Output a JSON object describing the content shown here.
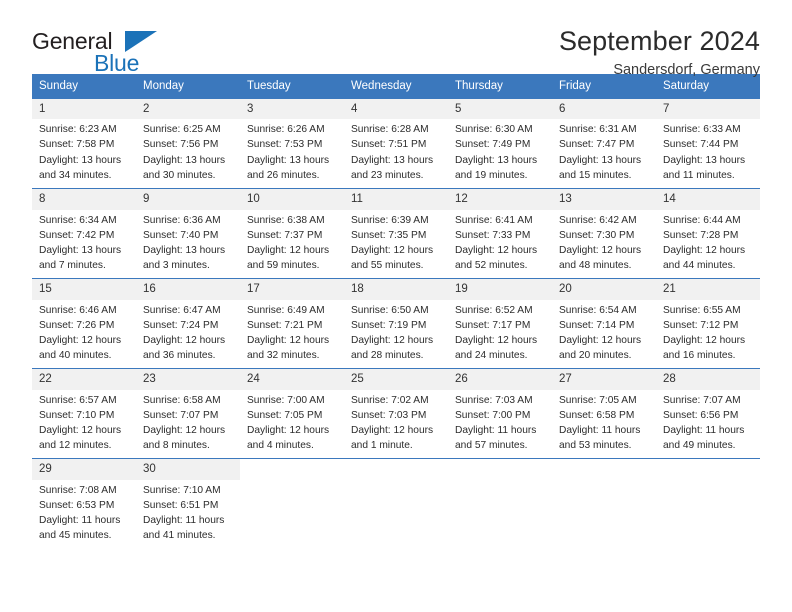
{
  "brand": {
    "line1": "General",
    "line2": "Blue",
    "triangle_color": "#1b72b8"
  },
  "header": {
    "title": "September 2024",
    "subtitle": "Sandersdorf, Germany"
  },
  "theme": {
    "header_blue": "#3b78bd",
    "daynum_gray": "#f1f1f1",
    "text": "#2c2c2c"
  },
  "columns": [
    "Sunday",
    "Monday",
    "Tuesday",
    "Wednesday",
    "Thursday",
    "Friday",
    "Saturday"
  ],
  "weeks": [
    [
      {
        "day": "1",
        "sunrise": "Sunrise: 6:23 AM",
        "sunset": "Sunset: 7:58 PM",
        "daylight1": "Daylight: 13 hours",
        "daylight2": "and 34 minutes."
      },
      {
        "day": "2",
        "sunrise": "Sunrise: 6:25 AM",
        "sunset": "Sunset: 7:56 PM",
        "daylight1": "Daylight: 13 hours",
        "daylight2": "and 30 minutes."
      },
      {
        "day": "3",
        "sunrise": "Sunrise: 6:26 AM",
        "sunset": "Sunset: 7:53 PM",
        "daylight1": "Daylight: 13 hours",
        "daylight2": "and 26 minutes."
      },
      {
        "day": "4",
        "sunrise": "Sunrise: 6:28 AM",
        "sunset": "Sunset: 7:51 PM",
        "daylight1": "Daylight: 13 hours",
        "daylight2": "and 23 minutes."
      },
      {
        "day": "5",
        "sunrise": "Sunrise: 6:30 AM",
        "sunset": "Sunset: 7:49 PM",
        "daylight1": "Daylight: 13 hours",
        "daylight2": "and 19 minutes."
      },
      {
        "day": "6",
        "sunrise": "Sunrise: 6:31 AM",
        "sunset": "Sunset: 7:47 PM",
        "daylight1": "Daylight: 13 hours",
        "daylight2": "and 15 minutes."
      },
      {
        "day": "7",
        "sunrise": "Sunrise: 6:33 AM",
        "sunset": "Sunset: 7:44 PM",
        "daylight1": "Daylight: 13 hours",
        "daylight2": "and 11 minutes."
      }
    ],
    [
      {
        "day": "8",
        "sunrise": "Sunrise: 6:34 AM",
        "sunset": "Sunset: 7:42 PM",
        "daylight1": "Daylight: 13 hours",
        "daylight2": "and 7 minutes."
      },
      {
        "day": "9",
        "sunrise": "Sunrise: 6:36 AM",
        "sunset": "Sunset: 7:40 PM",
        "daylight1": "Daylight: 13 hours",
        "daylight2": "and 3 minutes."
      },
      {
        "day": "10",
        "sunrise": "Sunrise: 6:38 AM",
        "sunset": "Sunset: 7:37 PM",
        "daylight1": "Daylight: 12 hours",
        "daylight2": "and 59 minutes."
      },
      {
        "day": "11",
        "sunrise": "Sunrise: 6:39 AM",
        "sunset": "Sunset: 7:35 PM",
        "daylight1": "Daylight: 12 hours",
        "daylight2": "and 55 minutes."
      },
      {
        "day": "12",
        "sunrise": "Sunrise: 6:41 AM",
        "sunset": "Sunset: 7:33 PM",
        "daylight1": "Daylight: 12 hours",
        "daylight2": "and 52 minutes."
      },
      {
        "day": "13",
        "sunrise": "Sunrise: 6:42 AM",
        "sunset": "Sunset: 7:30 PM",
        "daylight1": "Daylight: 12 hours",
        "daylight2": "and 48 minutes."
      },
      {
        "day": "14",
        "sunrise": "Sunrise: 6:44 AM",
        "sunset": "Sunset: 7:28 PM",
        "daylight1": "Daylight: 12 hours",
        "daylight2": "and 44 minutes."
      }
    ],
    [
      {
        "day": "15",
        "sunrise": "Sunrise: 6:46 AM",
        "sunset": "Sunset: 7:26 PM",
        "daylight1": "Daylight: 12 hours",
        "daylight2": "and 40 minutes."
      },
      {
        "day": "16",
        "sunrise": "Sunrise: 6:47 AM",
        "sunset": "Sunset: 7:24 PM",
        "daylight1": "Daylight: 12 hours",
        "daylight2": "and 36 minutes."
      },
      {
        "day": "17",
        "sunrise": "Sunrise: 6:49 AM",
        "sunset": "Sunset: 7:21 PM",
        "daylight1": "Daylight: 12 hours",
        "daylight2": "and 32 minutes."
      },
      {
        "day": "18",
        "sunrise": "Sunrise: 6:50 AM",
        "sunset": "Sunset: 7:19 PM",
        "daylight1": "Daylight: 12 hours",
        "daylight2": "and 28 minutes."
      },
      {
        "day": "19",
        "sunrise": "Sunrise: 6:52 AM",
        "sunset": "Sunset: 7:17 PM",
        "daylight1": "Daylight: 12 hours",
        "daylight2": "and 24 minutes."
      },
      {
        "day": "20",
        "sunrise": "Sunrise: 6:54 AM",
        "sunset": "Sunset: 7:14 PM",
        "daylight1": "Daylight: 12 hours",
        "daylight2": "and 20 minutes."
      },
      {
        "day": "21",
        "sunrise": "Sunrise: 6:55 AM",
        "sunset": "Sunset: 7:12 PM",
        "daylight1": "Daylight: 12 hours",
        "daylight2": "and 16 minutes."
      }
    ],
    [
      {
        "day": "22",
        "sunrise": "Sunrise: 6:57 AM",
        "sunset": "Sunset: 7:10 PM",
        "daylight1": "Daylight: 12 hours",
        "daylight2": "and 12 minutes."
      },
      {
        "day": "23",
        "sunrise": "Sunrise: 6:58 AM",
        "sunset": "Sunset: 7:07 PM",
        "daylight1": "Daylight: 12 hours",
        "daylight2": "and 8 minutes."
      },
      {
        "day": "24",
        "sunrise": "Sunrise: 7:00 AM",
        "sunset": "Sunset: 7:05 PM",
        "daylight1": "Daylight: 12 hours",
        "daylight2": "and 4 minutes."
      },
      {
        "day": "25",
        "sunrise": "Sunrise: 7:02 AM",
        "sunset": "Sunset: 7:03 PM",
        "daylight1": "Daylight: 12 hours",
        "daylight2": "and 1 minute."
      },
      {
        "day": "26",
        "sunrise": "Sunrise: 7:03 AM",
        "sunset": "Sunset: 7:00 PM",
        "daylight1": "Daylight: 11 hours",
        "daylight2": "and 57 minutes."
      },
      {
        "day": "27",
        "sunrise": "Sunrise: 7:05 AM",
        "sunset": "Sunset: 6:58 PM",
        "daylight1": "Daylight: 11 hours",
        "daylight2": "and 53 minutes."
      },
      {
        "day": "28",
        "sunrise": "Sunrise: 7:07 AM",
        "sunset": "Sunset: 6:56 PM",
        "daylight1": "Daylight: 11 hours",
        "daylight2": "and 49 minutes."
      }
    ],
    [
      {
        "day": "29",
        "sunrise": "Sunrise: 7:08 AM",
        "sunset": "Sunset: 6:53 PM",
        "daylight1": "Daylight: 11 hours",
        "daylight2": "and 45 minutes."
      },
      {
        "day": "30",
        "sunrise": "Sunrise: 7:10 AM",
        "sunset": "Sunset: 6:51 PM",
        "daylight1": "Daylight: 11 hours",
        "daylight2": "and 41 minutes."
      },
      {
        "day": "",
        "sunrise": "",
        "sunset": "",
        "daylight1": "",
        "daylight2": ""
      },
      {
        "day": "",
        "sunrise": "",
        "sunset": "",
        "daylight1": "",
        "daylight2": ""
      },
      {
        "day": "",
        "sunrise": "",
        "sunset": "",
        "daylight1": "",
        "daylight2": ""
      },
      {
        "day": "",
        "sunrise": "",
        "sunset": "",
        "daylight1": "",
        "daylight2": ""
      },
      {
        "day": "",
        "sunrise": "",
        "sunset": "",
        "daylight1": "",
        "daylight2": ""
      }
    ]
  ]
}
